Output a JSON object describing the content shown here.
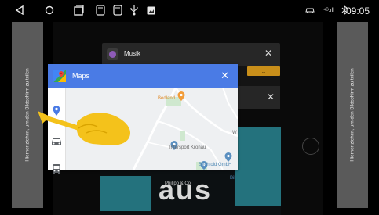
{
  "status_bar": {
    "clock": "09:05",
    "signal_label": "⁴ᴳ.ıll",
    "icons": [
      "back-icon",
      "home-icon",
      "recents-icon",
      "screenshot-icon",
      "notification-icon",
      "usb-icon",
      "gallery-icon",
      "car-icon",
      "signal-icon",
      "bluetooth-icon"
    ]
  },
  "side_panels": {
    "left_text": "Hierher ziehen, um den Bildschirm zu teilen",
    "right_text": "Hierher ziehen, um den Bildschirm zu teilen"
  },
  "recent_apps": {
    "musik": {
      "title": "Musik",
      "close": "✕",
      "badge": "⌄"
    },
    "card2": {
      "close": "✕"
    },
    "background_logo": "aus"
  },
  "maps_window": {
    "title": "Maps",
    "close": "✕",
    "nav_icons": [
      "location-icon",
      "car-icon",
      "bus-icon"
    ],
    "map_labels": {
      "bedland": "Bedland",
      "intersport": "Intersport Kronau",
      "bechtold": "Bechtold GmbH",
      "philipp": "Philipp & Co",
      "edge_w": "W",
      "edge_bil": "Bil"
    }
  },
  "colors": {
    "maps_header": "#4a7be5",
    "side_panel": "#5a5a5a",
    "teal": "#24727d",
    "badge_gold": "#c98f1a",
    "hand_yellow": "#f4c21b"
  }
}
